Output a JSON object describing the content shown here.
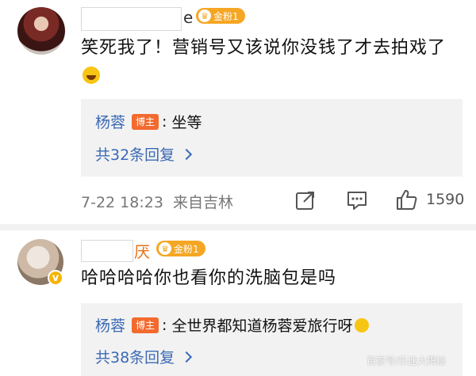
{
  "comments": [
    {
      "name_visible": "e",
      "fan_badge": "金粉1",
      "text": "笑死我了！营销号又该说你没钱了才去拍戏了",
      "reply": {
        "author": "杨蓉",
        "role": "博主",
        "text": "坐等"
      },
      "more_replies": "共32条回复",
      "timestamp": "7-22 18:23",
      "source": "来自吉林",
      "like_count": "1590"
    },
    {
      "name_visible": "厌",
      "fan_badge": "金粉1",
      "text": "哈哈哈哈你也看你的洗脑包是吗",
      "reply": {
        "author": "杨蓉",
        "role": "博主",
        "text": "全世界都知道杨蓉爱旅行呀"
      },
      "more_replies": "共38条回复"
    }
  ],
  "watermark": "百家号/乐迷大揭秘",
  "colors": {
    "link_blue": "#3b6ab5",
    "host_badge": "#f26a2e",
    "fan_badge": "#f5a623",
    "reply_bg": "#f2f2f2"
  },
  "icons": [
    "forward-icon",
    "comment-icon",
    "like-icon",
    "laugh-cry-emoji",
    "smile-emoji",
    "verified-v-badge"
  ]
}
